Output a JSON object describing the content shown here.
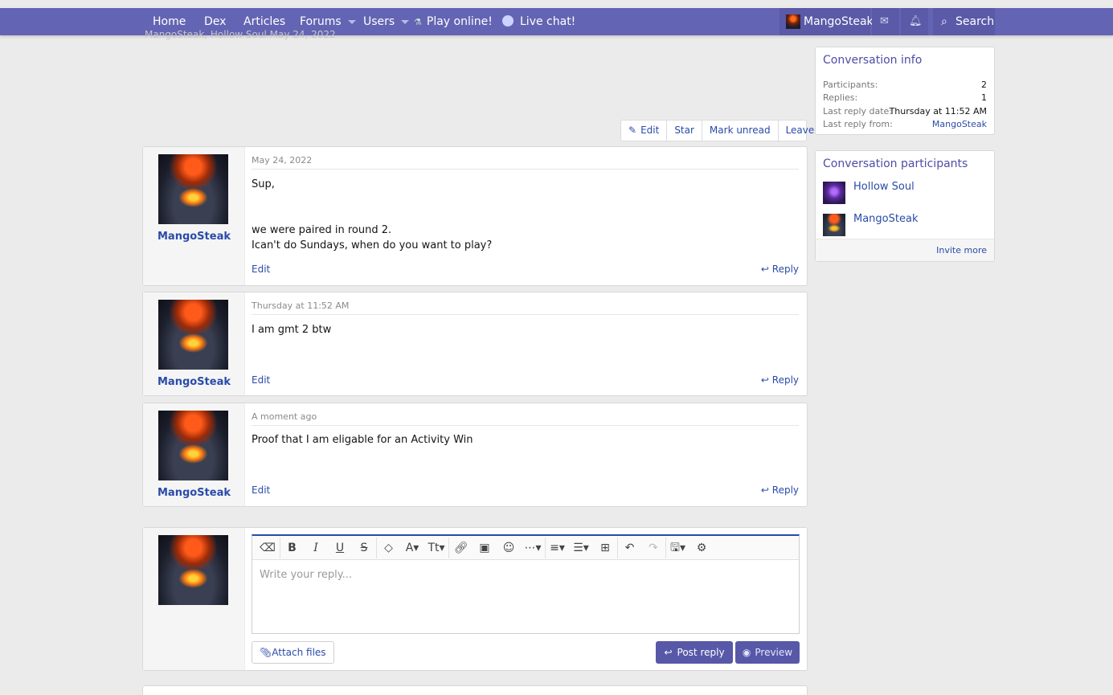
{
  "nav": {
    "items": [
      "Home",
      "Dex",
      "Articles",
      "Forums",
      "Users",
      "Play online!",
      "Live chat!"
    ],
    "username": "MangoSteak",
    "search_label": "Search",
    "color": "#6464b4"
  },
  "breadcrumb_ghost": "MangoSteak, Hollow Soul   May 24, 2022",
  "actions": {
    "edit": "Edit",
    "star": "Star",
    "mark_unread": "Mark unread",
    "leave": "Leave"
  },
  "messages": [
    {
      "author": "MangoSteak",
      "date": "May 24, 2022",
      "lines": [
        "Sup,",
        "",
        "",
        "we were paired in round 2.",
        "Ican't do Sundays, when do you want to play?"
      ],
      "edit": "Edit",
      "reply": "Reply"
    },
    {
      "author": "MangoSteak",
      "date": "Thursday at 11:52 AM",
      "lines": [
        "I am gmt 2 btw"
      ],
      "edit": "Edit",
      "reply": "Reply"
    },
    {
      "author": "MangoSteak",
      "date": "A moment ago",
      "lines": [
        "Proof that I am eligable for an Activity Win"
      ],
      "edit": "Edit",
      "reply": "Reply"
    }
  ],
  "reply_box": {
    "placeholder": "Write your reply...",
    "attach": "Attach files",
    "post": "Post reply",
    "preview": "Preview"
  },
  "sidebar": {
    "info": {
      "title": "Conversation info",
      "rows": [
        {
          "key": "Participants:",
          "value": "2"
        },
        {
          "key": "Replies:",
          "value": "1"
        },
        {
          "key": "Last reply date:",
          "value": "Thursday at 11:52 AM"
        },
        {
          "key": "Last reply from:",
          "value": "MangoSteak"
        }
      ]
    },
    "participants": {
      "title": "Conversation participants",
      "names": [
        "Hollow Soul",
        "MangoSteak"
      ],
      "invite": "Invite more"
    }
  }
}
